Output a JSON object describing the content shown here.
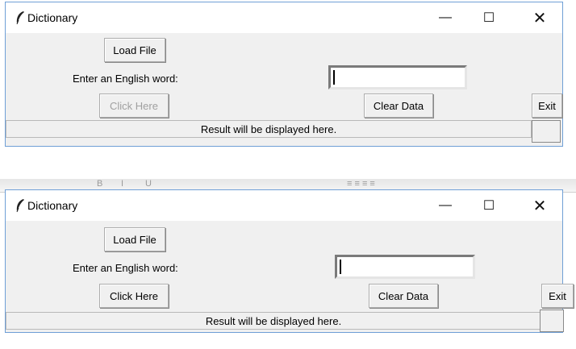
{
  "windows": [
    {
      "title": "Dictionary",
      "load_button": "Load File",
      "prompt_label": "Enter an English word:",
      "entry_value": "",
      "click_button": "Click Here",
      "click_disabled": true,
      "clear_button": "Clear Data",
      "exit_button": "Exit",
      "result_text": "Result will be displayed here."
    },
    {
      "title": "Dictionary",
      "load_button": "Load File",
      "prompt_label": "Enter an English word:",
      "entry_value": "",
      "click_button": "Click Here",
      "click_disabled": false,
      "clear_button": "Clear Data",
      "exit_button": "Exit",
      "result_text": "Result will be displayed here."
    }
  ],
  "window_controls": {
    "minimize": "—",
    "maximize": "☐",
    "close": "✕"
  },
  "icons": {
    "window_icon": "feather-icon"
  },
  "colors": {
    "window_border": "#6f9fd6",
    "window_bg": "#f0f0f0",
    "disabled_text": "#a0a0a0"
  }
}
